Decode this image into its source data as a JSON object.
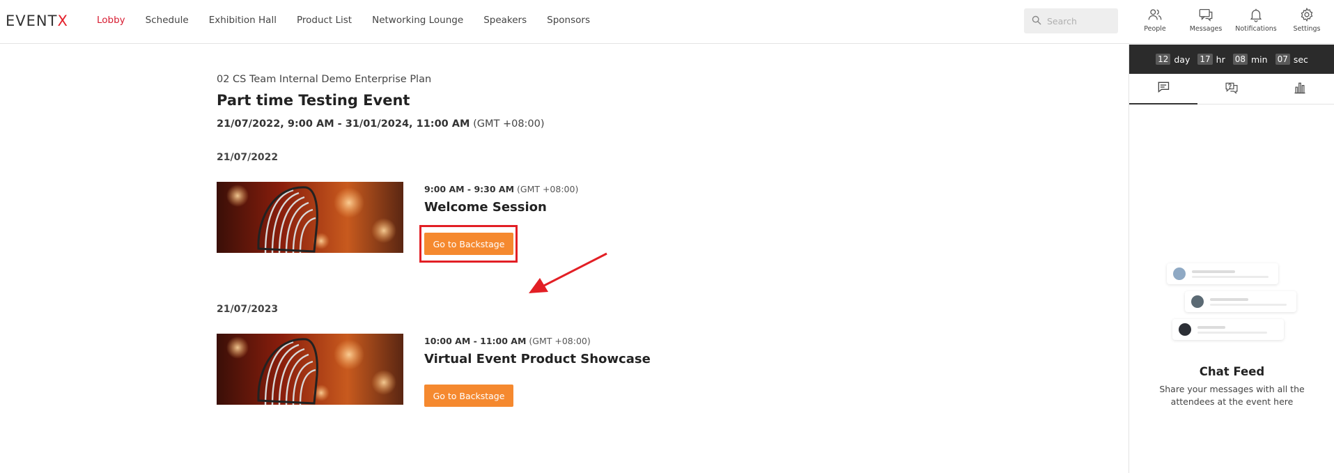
{
  "header": {
    "logo_main": "EVENT",
    "logo_accent": "X",
    "nav": [
      {
        "label": "Lobby",
        "active": true
      },
      {
        "label": "Schedule"
      },
      {
        "label": "Exhibition Hall"
      },
      {
        "label": "Product List"
      },
      {
        "label": "Networking Lounge"
      },
      {
        "label": "Speakers"
      },
      {
        "label": "Sponsors"
      }
    ],
    "search_placeholder": "Search",
    "icons": {
      "people": "People",
      "messages": "Messages",
      "notifications": "Notifications",
      "settings": "Settings"
    }
  },
  "event": {
    "org": "02 CS Team Internal Demo Enterprise Plan",
    "title": "Part time Testing Event",
    "range_bold": "21/07/2022, 9:00 AM - 31/01/2024, 11:00 AM",
    "range_tz": "(GMT +08:00)"
  },
  "days": [
    {
      "date": "21/07/2022",
      "session": {
        "time_bold": "9:00 AM - 9:30 AM",
        "time_tz": "(GMT +08:00)",
        "title": "Welcome Session",
        "button": "Go to Backstage"
      }
    },
    {
      "date": "21/07/2023",
      "session": {
        "time_bold": "10:00 AM - 11:00 AM",
        "time_tz": "(GMT +08:00)",
        "title": "Virtual Event Product Showcase",
        "button": "Go to Backstage"
      }
    }
  ],
  "sidebar": {
    "countdown": {
      "day_val": "12",
      "day_unit": "day",
      "hr_val": "17",
      "hr_unit": "hr",
      "min_val": "08",
      "min_unit": "min",
      "sec_val": "07",
      "sec_unit": "sec"
    },
    "feed_title": "Chat Feed",
    "feed_desc": "Share your messages with all the attendees at the event here"
  },
  "colors": {
    "brand_red": "#d71d32",
    "button_orange": "#f5892f",
    "annotation_red": "#e21f25"
  }
}
